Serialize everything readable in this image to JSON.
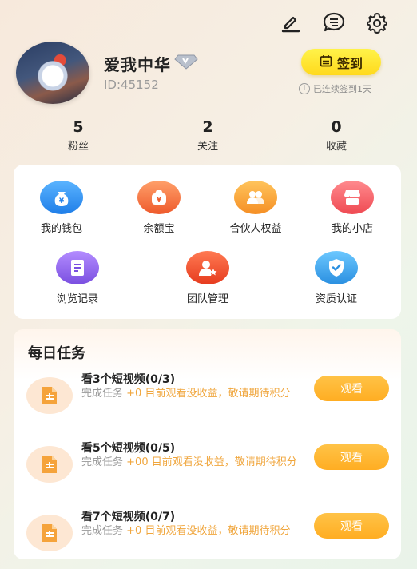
{
  "header": {
    "icons": [
      "edit-icon",
      "message-icon",
      "settings-icon"
    ],
    "username": "爱我中华",
    "user_id": "ID:45152",
    "checkin_label": "签到",
    "streak_text": "已连续签到1天"
  },
  "stats": [
    {
      "value": "5",
      "label": "粉丝"
    },
    {
      "value": "2",
      "label": "关注"
    },
    {
      "value": "0",
      "label": "收藏"
    }
  ],
  "menu": [
    {
      "label": "我的钱包",
      "icon": "wallet-icon",
      "color": "#2e8cf0"
    },
    {
      "label": "余额宝",
      "icon": "money-bag-icon",
      "color": "#f06a3a"
    },
    {
      "label": "合伙人权益",
      "icon": "partner-icon",
      "color": "#f7a33a"
    },
    {
      "label": "我的小店",
      "icon": "shop-icon",
      "color": "#f5585e"
    },
    {
      "label": "浏览记录",
      "icon": "history-icon",
      "color": "#8c63e8"
    },
    {
      "label": "团队管理",
      "icon": "team-icon",
      "color": "#f0542e"
    },
    {
      "label": "资质认证",
      "icon": "certify-icon",
      "color": "#34a6ea"
    }
  ],
  "tasks": {
    "title": "每日任务",
    "items": [
      {
        "name": "看3个短视频(0/3)",
        "prefix": "完成任务",
        "reward": "+0 目前观看没收益，敬请期待积分",
        "button": "观看"
      },
      {
        "name": "看5个短视频(0/5)",
        "prefix": "完成任务",
        "reward": "+00 目前观看没收益，敬请期待积分",
        "button": "观看"
      },
      {
        "name": "看7个短视频(0/7)",
        "prefix": "完成任务",
        "reward": "+0 目前观看没收益，敬请期待积分",
        "button": "观看"
      }
    ]
  }
}
